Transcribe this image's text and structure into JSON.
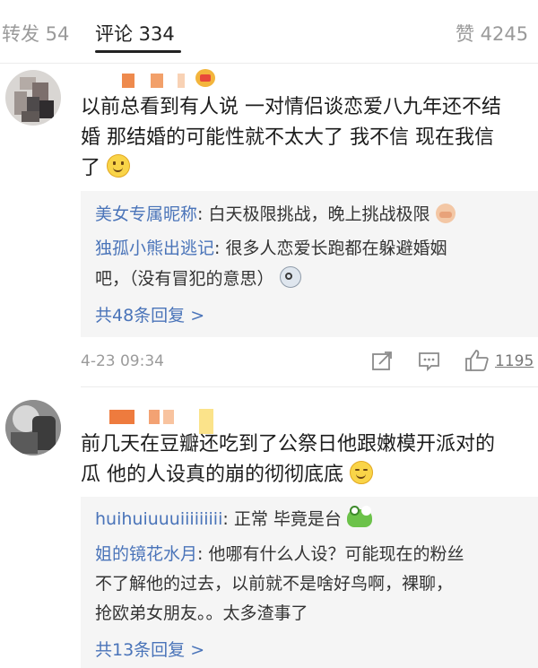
{
  "tabs": [
    {
      "label": "转发 54"
    },
    {
      "label": "评论 334"
    },
    {
      "label": "赞 4245"
    }
  ],
  "comments": [
    {
      "text_lines": [
        "以前总看到有人说 一对情侣谈恋爱八九年还不结",
        "婚 那结婚的可能性就不太大了 我不信 现在我信",
        "了"
      ],
      "emoji": "smile-emoji",
      "replies": [
        {
          "name": "美女专属昵称",
          "sep": ": ",
          "text": "白天极限挑战，晚上挑战极限",
          "emoji": "hands-emoji"
        },
        {
          "name": "独孤小熊出逃记",
          "sep": ": ",
          "text": "很多人恋爱长跑都在躲避婚姻",
          "text2": "吧，（没有冒犯的意思）",
          "emoji": "dizzy-emoji"
        }
      ],
      "more_replies": "共48条回复 >",
      "time": "4-23 09:34",
      "like_count": "1195"
    },
    {
      "text_lines": [
        "前几天在豆瓣还吃到了公祭日他跟嫩模开派对的",
        "瓜 他的人设真的崩的彻彻底底"
      ],
      "emoji": "sweat-smile-emoji",
      "replies": [
        {
          "name": "huihuiuuuiiiiiiiii",
          "sep": ": ",
          "text": "正常 毕竟是台",
          "emoji": "frog-emoji"
        },
        {
          "name": "姐的镜花水月",
          "sep": ": ",
          "text": "他哪有什么人设？可能现在的粉丝",
          "text2": "不了解他的过去，以前就不是啥好鸟啊，裸聊，",
          "text3": "抢欧弟女朋友。。太多渣事了"
        }
      ],
      "more_replies": "共13条回复 >"
    }
  ],
  "colors": {
    "link": "#4a74b9",
    "reply_bg": "#f5f5f5",
    "meta": "#9b9b9b"
  }
}
